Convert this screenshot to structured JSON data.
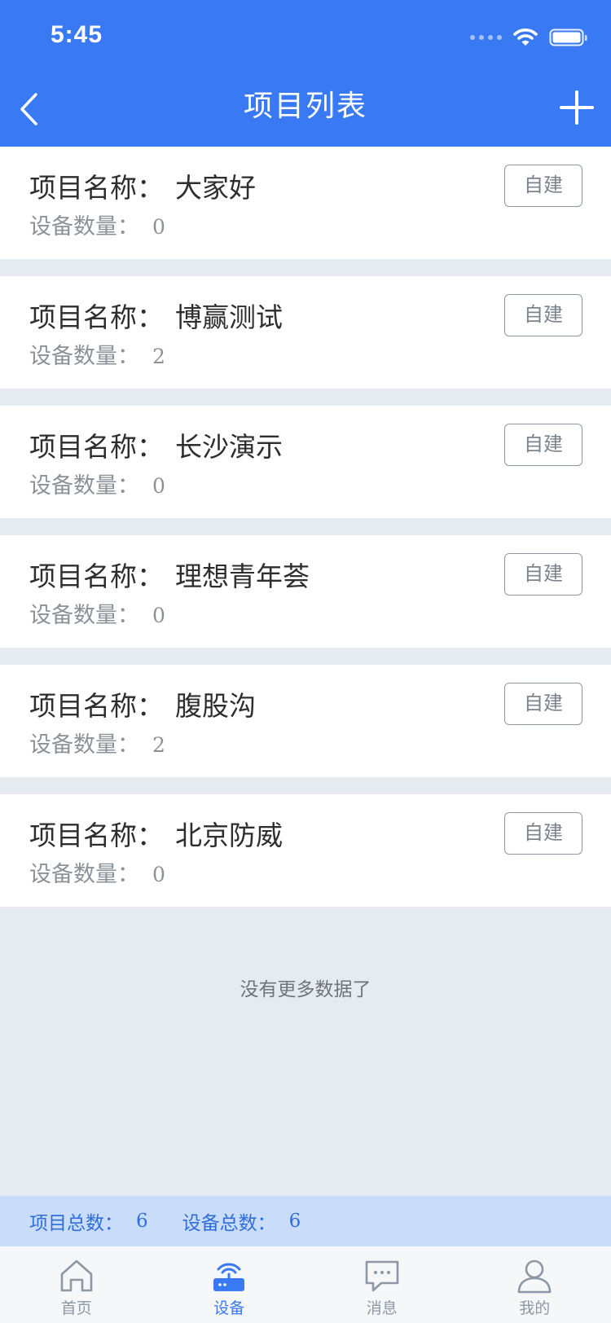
{
  "status_bar": {
    "time": "5:45"
  },
  "nav": {
    "title": "项目列表"
  },
  "project_label": "项目名称：",
  "device_label": "设备数量：",
  "tag_label": "自建",
  "projects": [
    {
      "name": "大家好",
      "device_count": "0"
    },
    {
      "name": "博赢测试",
      "device_count": "2"
    },
    {
      "name": "长沙演示",
      "device_count": "0"
    },
    {
      "name": "理想青年荟",
      "device_count": "0"
    },
    {
      "name": "腹股沟",
      "device_count": "2"
    },
    {
      "name": "北京防威",
      "device_count": "0"
    }
  ],
  "list_end_text": "没有更多数据了",
  "summary": {
    "project_total_label": "项目总数：",
    "project_total": "6",
    "device_total_label": "设备总数：",
    "device_total": "6"
  },
  "tabbar": {
    "tabs": [
      {
        "label": "首页",
        "icon": "home-icon",
        "active": false
      },
      {
        "label": "设备",
        "icon": "router-icon",
        "active": true
      },
      {
        "label": "消息",
        "icon": "message-icon",
        "active": false
      },
      {
        "label": "我的",
        "icon": "user-icon",
        "active": false
      }
    ]
  },
  "colors": {
    "primary": "#3a79f4",
    "background": "#e6ebf1",
    "summary_bg": "#c9ddfb"
  }
}
